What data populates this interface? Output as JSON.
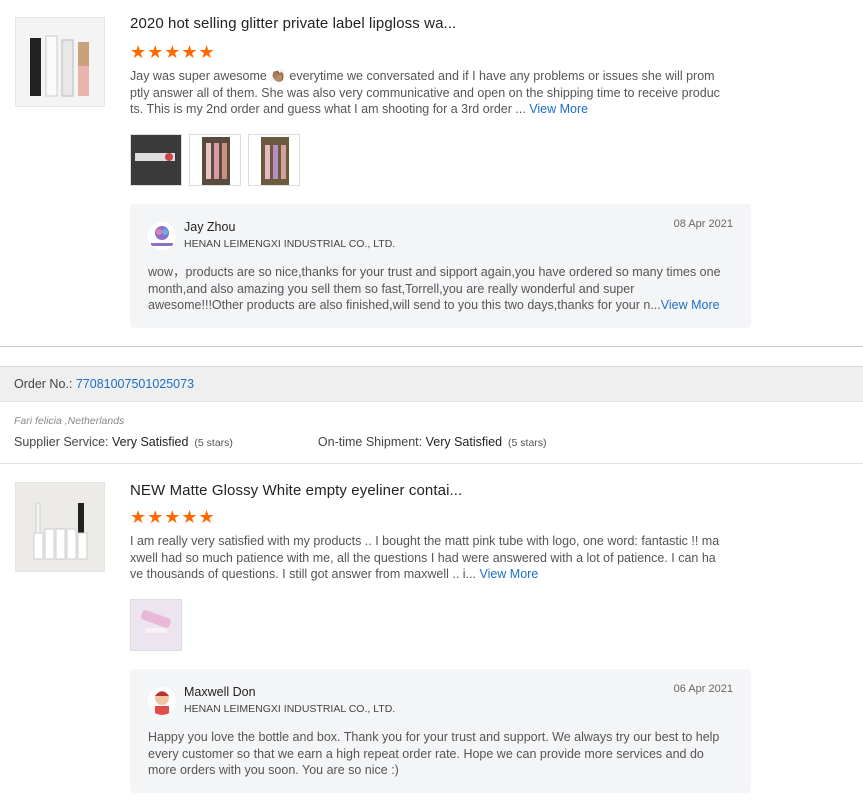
{
  "reviews": [
    {
      "title": "2020 hot selling glitter private label lipgloss wa...",
      "stars": "★★★★★",
      "text": "Jay was super awesome 👏🏽 everytime we conversated and if I have any problems or issues she will promptly answer all of them. She was also very communicative and open on the shipping time to receive products. This is my 2nd order and guess what I am shooting for a 3rd order ... ",
      "view_more": "View More",
      "reply": {
        "name": "Jay Zhou",
        "company": "HENAN LEIMENGXI INDUSTRIAL CO., LTD.",
        "date": "08 Apr 2021",
        "text": "wow，products are so nice,thanks for your trust and sipport again,you have ordered so many times one month,and also amazing you sell them so fast,Torrell,you are really wonderful and super awesome!!!Other products are also finished,will send to you this two days,thanks for your n...",
        "view_more": "View More"
      }
    },
    {
      "title": "NEW Matte Glossy White empty eyeliner contai...",
      "stars": "★★★★★",
      "text": "I am really very satisfied with my products .. I bought the matt pink tube with logo, one word: fantastic !! maxwell had so much patience with me, all the questions I had were answered with a lot of patience. I can have thousands of questions. I still got answer from maxwell .. i... ",
      "view_more": "View More",
      "reply": {
        "name": "Maxwell Don",
        "company": "HENAN LEIMENGXI INDUSTRIAL CO., LTD.",
        "date": "06 Apr 2021",
        "text": "Happy you love the bottle and box. Thank you for your trust and support. We always try our best to help every customer so that we earn a high repeat order rate. Hope we can provide more services and do more orders  with you soon. You are so nice :)"
      }
    }
  ],
  "order": {
    "label": "Order No.:",
    "number": "77081007501025073",
    "buyer": "Fari felicia ,Netherlands",
    "supplier_service_label": "Supplier Service:",
    "supplier_service_value": "Very Satisfied",
    "supplier_service_stars": "(5 stars)",
    "shipment_label": "On-time Shipment:",
    "shipment_value": "Very Satisfied",
    "shipment_stars": "(5 stars)"
  },
  "colors": {
    "star": "#ff6a00",
    "link": "#1b6fc8",
    "reply_bg": "#f4f5f7"
  }
}
